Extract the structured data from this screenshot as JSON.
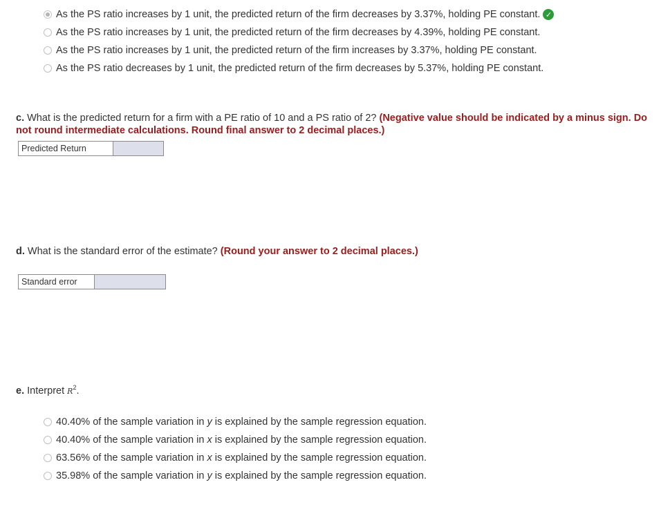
{
  "part_b": {
    "options": [
      {
        "text": "As the PS ratio increases by 1 unit, the predicted return of the firm decreases by 3.37%, holding PE constant.",
        "selected": true,
        "correct": true
      },
      {
        "text": "As the PS ratio increases by 1 unit, the predicted return of the firm decreases by 4.39%, holding PE constant.",
        "selected": false
      },
      {
        "text": "As the PS ratio increases by 1 unit, the predicted return of the firm increases by 3.37%, holding PE constant.",
        "selected": false
      },
      {
        "text": "As the PS ratio decreases by 1 unit, the predicted return of the firm decreases by 5.37%, holding PE constant.",
        "selected": false
      }
    ]
  },
  "part_c": {
    "label": "c.",
    "question": " What is the predicted return for a firm with a PE ratio of 10 and a PS ratio of 2? ",
    "instruction": "(Negative value should be indicated by a minus sign. Do not round intermediate calculations. Round final answer to 2 decimal places.)",
    "field_label": "Predicted Return",
    "field_value": ""
  },
  "part_d": {
    "label": "d.",
    "question": " What is the standard error of the estimate? ",
    "instruction": "(Round your answer to 2 decimal places.)",
    "field_label": "Standard error",
    "field_value": ""
  },
  "part_e": {
    "label": "e.",
    "question": " Interpret ",
    "symbol": "R",
    "superscript": "2",
    "period": ".",
    "options": [
      {
        "pre": "40.40% of the sample variation in ",
        "var": "y",
        "post": " is explained by the sample regression equation."
      },
      {
        "pre": "40.40% of the sample variation in ",
        "var": "x",
        "post": " is explained by the sample regression equation."
      },
      {
        "pre": "63.56% of the sample variation in ",
        "var": "x",
        "post": " is explained by the sample regression equation."
      },
      {
        "pre": "35.98% of the sample variation in ",
        "var": "y",
        "post": " is explained by the sample regression equation."
      }
    ]
  },
  "colors": {
    "instruction": "#9b1c1c",
    "correct_check": "#2e9b3a",
    "input_bg": "#dde0ea"
  }
}
